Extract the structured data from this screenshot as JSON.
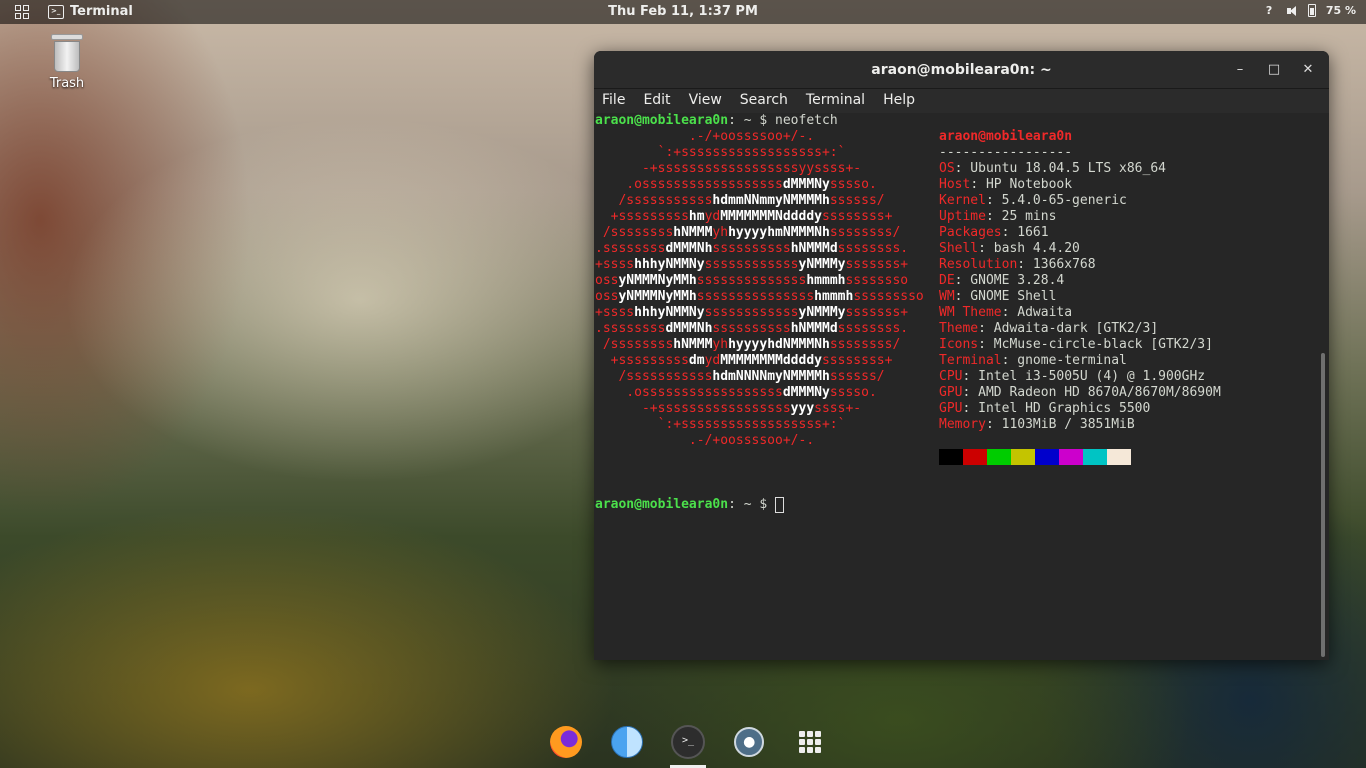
{
  "topbar": {
    "app_name": "Terminal",
    "clock": "Thu Feb 11,  1:37 PM",
    "battery": "75 %"
  },
  "desktop": {
    "trash_label": "Trash"
  },
  "window": {
    "title": "araon@mobileara0n: ~",
    "buttons": {
      "minimize": "–",
      "maximize": "□",
      "close": "✕"
    },
    "menu": [
      "File",
      "Edit",
      "View",
      "Search",
      "Terminal",
      "Help"
    ]
  },
  "terminal": {
    "prompt_user": "araon@mobileara0n",
    "prompt_rest": ": ",
    "prompt_path": "~",
    "prompt_sym": "$ ",
    "command": "neofetch",
    "logo_lines": [
      [
        [
          "r",
          "            .-/+oossssoo+/-."
        ]
      ],
      [
        [
          "r",
          "        `:+ssssssssssssssssss+:`"
        ]
      ],
      [
        [
          "r",
          "      -+ssssssssssssssssssyyssss+-"
        ]
      ],
      [
        [
          "r",
          "    .ossssssssssssssssss"
        ],
        [
          "w",
          "dMMMNy"
        ],
        [
          "r",
          "sssso."
        ]
      ],
      [
        [
          "r",
          "   /sssssssssss"
        ],
        [
          "w",
          "hdmmNNmmyNMMMMh"
        ],
        [
          "r",
          "ssssss/"
        ]
      ],
      [
        [
          "r",
          "  +sssssssss"
        ],
        [
          "w",
          "hm"
        ],
        [
          "r",
          "yd"
        ],
        [
          "w",
          "MMMMMMMNddddy"
        ],
        [
          "r",
          "ssssssss+"
        ]
      ],
      [
        [
          "r",
          " /ssssssss"
        ],
        [
          "w",
          "hNMMM"
        ],
        [
          "r",
          "yh"
        ],
        [
          "w",
          "hyyyyhmNMMMNh"
        ],
        [
          "r",
          "ssssssss/"
        ]
      ],
      [
        [
          "r",
          ".ssssssss"
        ],
        [
          "w",
          "dMMMNh"
        ],
        [
          "r",
          "ssssssssss"
        ],
        [
          "w",
          "hNMMMd"
        ],
        [
          "r",
          "ssssssss."
        ]
      ],
      [
        [
          "r",
          "+ssss"
        ],
        [
          "w",
          "hhhyNMMNy"
        ],
        [
          "r",
          "ssssssssssss"
        ],
        [
          "w",
          "yNMMMy"
        ],
        [
          "r",
          "sssssss+"
        ]
      ],
      [
        [
          "r",
          "oss"
        ],
        [
          "w",
          "yNMMMNyMMh"
        ],
        [
          "r",
          "ssssssssssssss"
        ],
        [
          "w",
          "hmmmh"
        ],
        [
          "r",
          "ssssssso"
        ]
      ],
      [
        [
          "r",
          "oss"
        ],
        [
          "w",
          "yNMMMNyMMh"
        ],
        [
          "r",
          "sssssssssssssss"
        ],
        [
          "w",
          "hmmmh"
        ],
        [
          "r",
          "sssssssso"
        ]
      ],
      [
        [
          "r",
          "+ssss"
        ],
        [
          "w",
          "hhhyNMMNy"
        ],
        [
          "r",
          "ssssssssssss"
        ],
        [
          "w",
          "yNMMMy"
        ],
        [
          "r",
          "sssssss+"
        ]
      ],
      [
        [
          "r",
          ".ssssssss"
        ],
        [
          "w",
          "dMMMNh"
        ],
        [
          "r",
          "ssssssssss"
        ],
        [
          "w",
          "hNMMMd"
        ],
        [
          "r",
          "ssssssss."
        ]
      ],
      [
        [
          "r",
          " /ssssssss"
        ],
        [
          "w",
          "hNMMM"
        ],
        [
          "r",
          "yh"
        ],
        [
          "w",
          "hyyyyhdNMMMNh"
        ],
        [
          "r",
          "ssssssss/"
        ]
      ],
      [
        [
          "r",
          "  +sssssssss"
        ],
        [
          "w",
          "dm"
        ],
        [
          "r",
          "yd"
        ],
        [
          "w",
          "MMMMMMMMddddy"
        ],
        [
          "r",
          "ssssssss+"
        ]
      ],
      [
        [
          "r",
          "   /sssssssssss"
        ],
        [
          "w",
          "hdmNNNNmyNMMMMh"
        ],
        [
          "r",
          "ssssss/"
        ]
      ],
      [
        [
          "r",
          "    .ossssssssssssssssss"
        ],
        [
          "w",
          "dMMMNy"
        ],
        [
          "r",
          "sssso."
        ]
      ],
      [
        [
          "r",
          "      -+sssssssssssssssss"
        ],
        [
          "w",
          "yyy"
        ],
        [
          "r",
          "ssss+-"
        ]
      ],
      [
        [
          "r",
          "        `:+ssssssssssssssssss+:`"
        ]
      ],
      [
        [
          "r",
          "            .-/+oossssoo+/-."
        ]
      ]
    ],
    "info_header": "araon@mobileara0n",
    "info_separator": "-----------------",
    "info": [
      {
        "k": "OS",
        "v": ": Ubuntu 18.04.5 LTS x86_64"
      },
      {
        "k": "Host",
        "v": ": HP Notebook"
      },
      {
        "k": "Kernel",
        "v": ": 5.4.0-65-generic"
      },
      {
        "k": "Uptime",
        "v": ": 25 mins"
      },
      {
        "k": "Packages",
        "v": ": 1661"
      },
      {
        "k": "Shell",
        "v": ": bash 4.4.20"
      },
      {
        "k": "Resolution",
        "v": ": 1366x768"
      },
      {
        "k": "DE",
        "v": ": GNOME 3.28.4"
      },
      {
        "k": "WM",
        "v": ": GNOME Shell"
      },
      {
        "k": "WM Theme",
        "v": ": Adwaita"
      },
      {
        "k": "Theme",
        "v": ": Adwaita-dark [GTK2/3]"
      },
      {
        "k": "Icons",
        "v": ": McMuse-circle-black [GTK2/3]"
      },
      {
        "k": "Terminal",
        "v": ": gnome-terminal"
      },
      {
        "k": "CPU",
        "v": ": Intel i3-5005U (4) @ 1.900GHz"
      },
      {
        "k": "GPU",
        "v": ": AMD Radeon HD 8670A/8670M/8690M"
      },
      {
        "k": "GPU",
        "v": ": Intel HD Graphics 5500"
      },
      {
        "k": "Memory",
        "v": ": 1103MiB / 3851MiB"
      }
    ],
    "color_swatches": [
      "#000000",
      "#cc0000",
      "#00cc00",
      "#c4c400",
      "#0000cc",
      "#cc00cc",
      "#00c4c4",
      "#f5e8d8"
    ]
  },
  "dock": {
    "items": [
      "firefox-icon",
      "finder-icon",
      "terminal-icon",
      "drop-icon",
      "show-apps-icon"
    ],
    "terminal_glyph": ">_",
    "drop_glyph": "●"
  }
}
